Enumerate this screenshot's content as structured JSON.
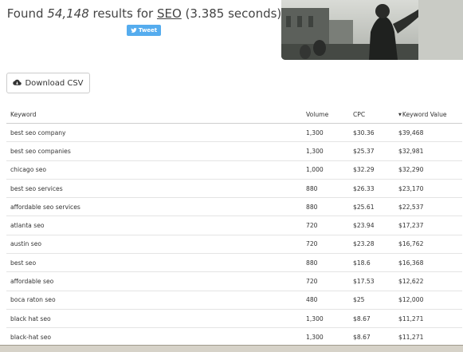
{
  "results": {
    "prefix": "Found ",
    "count": "54,148",
    "middle": " results for ",
    "query": "SEO",
    "time": " (3.385 seconds)"
  },
  "tweet_label": "Tweet",
  "download_label": "Download CSV",
  "table": {
    "headers": [
      "Keyword",
      "Volume",
      "CPC",
      "Keyword Value"
    ],
    "rows": [
      [
        "best seo company",
        "1,300",
        "$30.36",
        "$39,468"
      ],
      [
        "best seo companies",
        "1,300",
        "$25.37",
        "$32,981"
      ],
      [
        "chicago seo",
        "1,000",
        "$32.29",
        "$32,290"
      ],
      [
        "best seo services",
        "880",
        "$26.33",
        "$23,170"
      ],
      [
        "affordable seo services",
        "880",
        "$25.61",
        "$22,537"
      ],
      [
        "atlanta seo",
        "720",
        "$23.94",
        "$17,237"
      ],
      [
        "austin seo",
        "720",
        "$23.28",
        "$16,762"
      ],
      [
        "best seo",
        "880",
        "$18.6",
        "$16,368"
      ],
      [
        "affordable seo",
        "720",
        "$17.53",
        "$12,622"
      ],
      [
        "boca raton seo",
        "480",
        "$25",
        "$12,000"
      ],
      [
        "black hat seo",
        "1,300",
        "$8.67",
        "$11,271"
      ],
      [
        "black-hat seo",
        "1,300",
        "$8.67",
        "$11,271"
      ]
    ]
  }
}
